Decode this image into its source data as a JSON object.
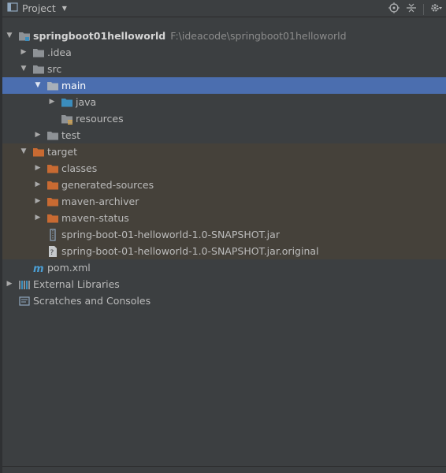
{
  "toolbar": {
    "title": "Project",
    "icons": [
      "project-view-icon",
      "dropdown-caret-icon",
      "locate-icon",
      "collapse-all-icon",
      "settings-gear-icon"
    ]
  },
  "tree": {
    "root": {
      "label": "springboot01helloworld",
      "path": "F:\\ideacode\\springboot01helloworld"
    },
    "idea": {
      "label": ".idea"
    },
    "src": {
      "label": "src"
    },
    "main": {
      "label": "main"
    },
    "java": {
      "label": "java"
    },
    "resources": {
      "label": "resources"
    },
    "test": {
      "label": "test"
    },
    "target": {
      "label": "target"
    },
    "classes": {
      "label": "classes"
    },
    "generated_sources": {
      "label": "generated-sources"
    },
    "maven_archiver": {
      "label": "maven-archiver"
    },
    "maven_status": {
      "label": "maven-status"
    },
    "jar": {
      "label": "spring-boot-01-helloworld-1.0-SNAPSHOT.jar"
    },
    "jar_original": {
      "label": "spring-boot-01-helloworld-1.0-SNAPSHOT.jar.original"
    },
    "pom": {
      "label": "pom.xml"
    },
    "external_libraries": {
      "label": "External Libraries"
    },
    "scratches": {
      "label": "Scratches and Consoles"
    }
  },
  "colors": {
    "background": "#3c3f41",
    "selection": "#4b6eaf",
    "excluded_target": "#45413a",
    "folder_gray": "#8e9296",
    "folder_blue": "#3b8dbd",
    "folder_orange": "#c86a32"
  }
}
